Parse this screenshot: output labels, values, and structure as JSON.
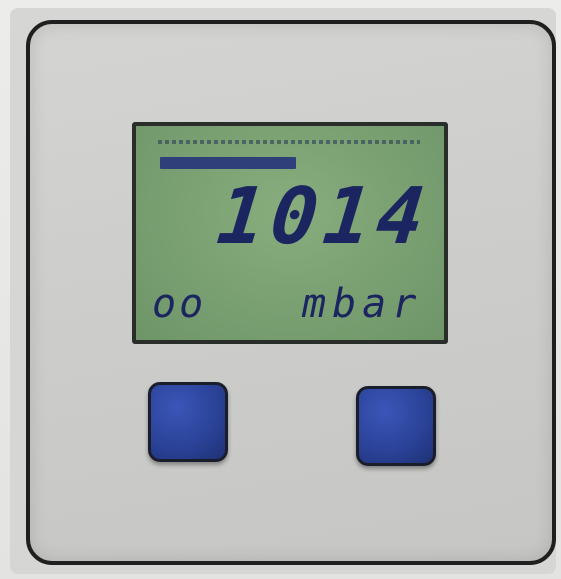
{
  "display": {
    "value": "1014",
    "mode": "oo",
    "unit": "mbar"
  },
  "colors": {
    "lcd_background": "#7ca274",
    "lcd_segments": "#1b2560",
    "button_blue": "#2b4399",
    "panel": "#cdcdcb"
  }
}
